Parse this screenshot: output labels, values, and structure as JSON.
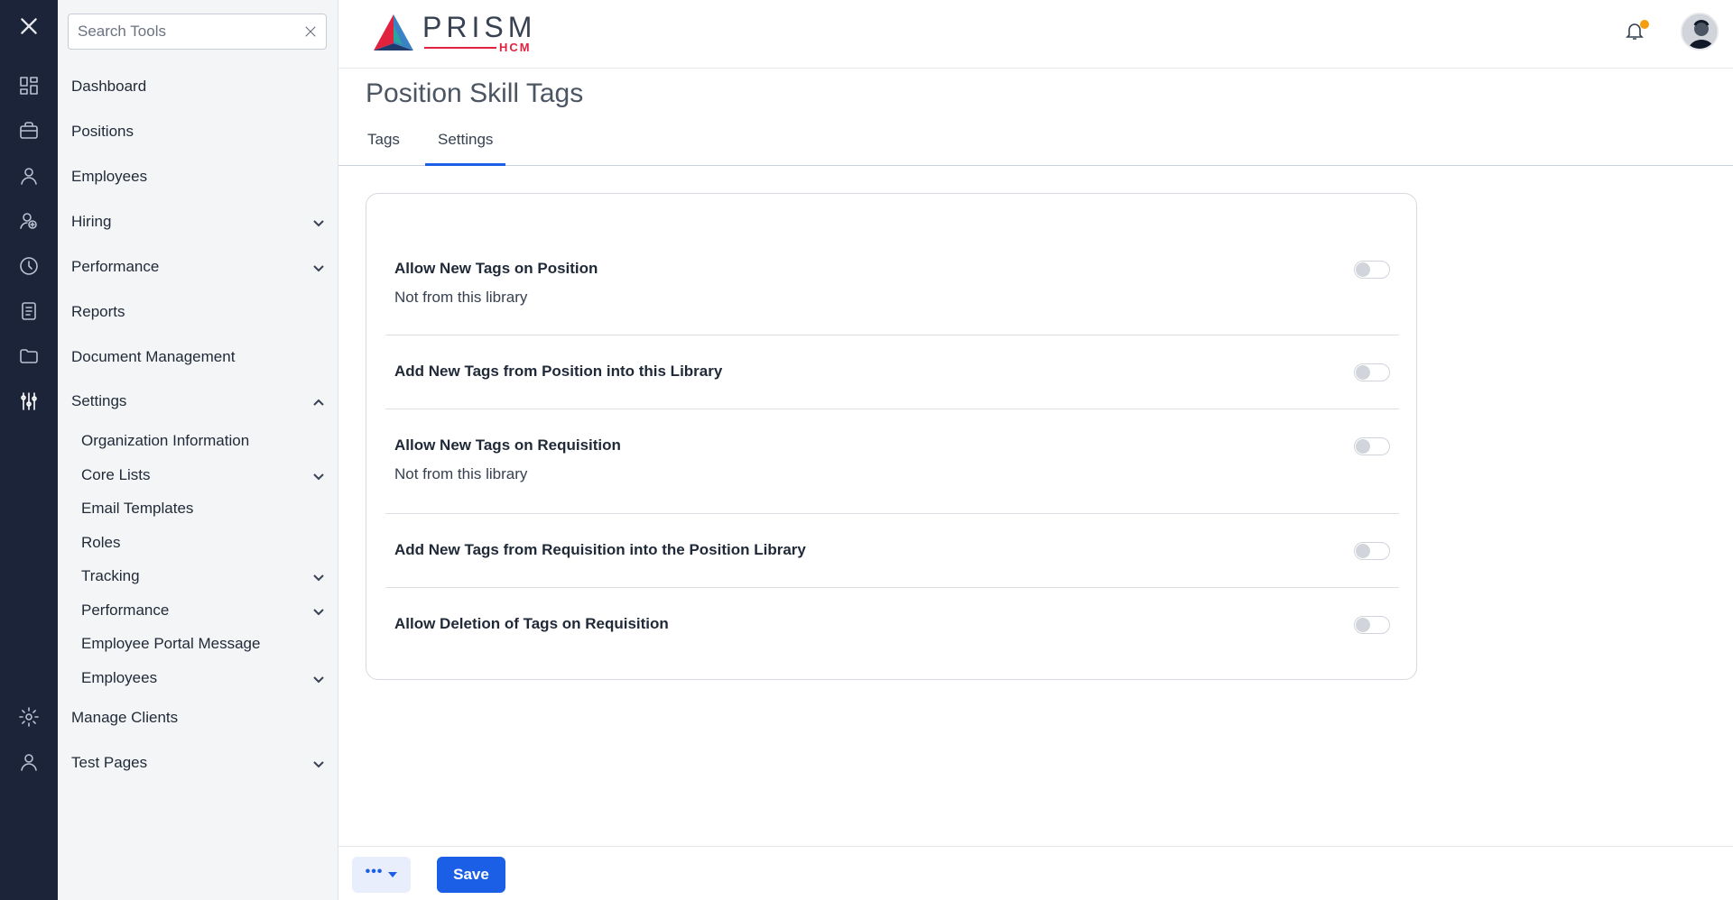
{
  "search": {
    "placeholder": "Search Tools"
  },
  "rail": {
    "icons": [
      "close-icon",
      "dashboard-icon",
      "briefcase-icon",
      "user-icon",
      "hiring-icon",
      "performance-icon",
      "reports-icon",
      "folder-icon",
      "settings-sliders-icon",
      "gear-icon",
      "account-icon"
    ]
  },
  "menu": {
    "items": [
      {
        "label": "Dashboard",
        "expandable": false
      },
      {
        "label": "Positions",
        "expandable": false
      },
      {
        "label": "Employees",
        "expandable": false
      },
      {
        "label": "Hiring",
        "expandable": true
      },
      {
        "label": "Performance",
        "expandable": true
      },
      {
        "label": "Reports",
        "expandable": false
      },
      {
        "label": "Document Management",
        "expandable": false
      },
      {
        "label": "Settings",
        "expandable": true,
        "expanded": true
      }
    ],
    "settings_children": [
      {
        "label": "Organization Information",
        "expandable": false
      },
      {
        "label": "Core Lists",
        "expandable": true
      },
      {
        "label": "Email Templates",
        "expandable": false
      },
      {
        "label": "Roles",
        "expandable": false
      },
      {
        "label": "Tracking",
        "expandable": true
      },
      {
        "label": "Performance",
        "expandable": true
      },
      {
        "label": "Employee Portal Message",
        "expandable": false
      },
      {
        "label": "Employees",
        "expandable": true
      }
    ],
    "after": [
      {
        "label": "Manage Clients",
        "expandable": false
      },
      {
        "label": "Test Pages",
        "expandable": true
      }
    ]
  },
  "header": {
    "logo_word": "PRISM",
    "logo_sub": "HCM",
    "notification_dot_color": "#f59e0b"
  },
  "page": {
    "title": "Position Skill Tags",
    "tabs": [
      {
        "label": "Tags",
        "active": false
      },
      {
        "label": "Settings",
        "active": true
      }
    ]
  },
  "settings": [
    {
      "label": "Allow New Tags on Position",
      "sub": "Not from this library",
      "enabled": false
    },
    {
      "label": "Add New Tags from Position into this Library",
      "sub": "",
      "enabled": false
    },
    {
      "label": "Allow New Tags on Requisition",
      "sub": "Not from this library",
      "enabled": false
    },
    {
      "label": "Add New Tags from Requisition into the Position Library",
      "sub": "",
      "enabled": false
    },
    {
      "label": "Allow Deletion of Tags on Requisition",
      "sub": "",
      "enabled": false
    }
  ],
  "footer": {
    "more_label": "•••",
    "save_label": "Save"
  },
  "colors": {
    "rail_bg": "#1b2438",
    "accent": "#1b5fe6",
    "brand_red": "#e0223f"
  }
}
